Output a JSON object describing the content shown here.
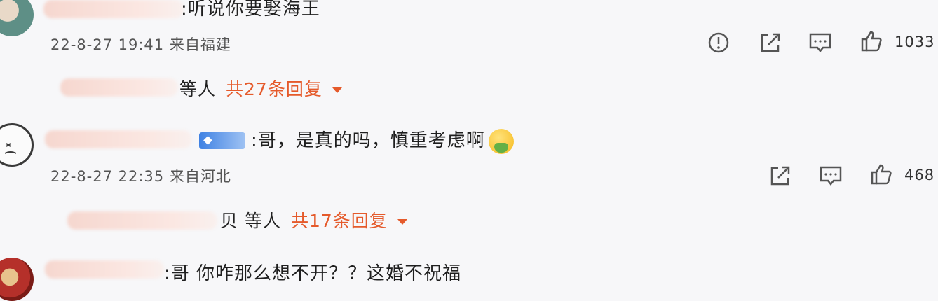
{
  "comments": [
    {
      "text": ":听说你要娶海王",
      "meta": "22-8-27 19:41 来自福建",
      "likes": "1033",
      "replies": {
        "who_suffix": "等人",
        "count": "共27条回复"
      }
    },
    {
      "text": ":哥，是真的吗，慎重考虑啊",
      "meta": "22-8-27 22:35 来自河北",
      "likes": "468",
      "replies": {
        "who_suffix": "贝 等人",
        "count": "共17条回复"
      }
    },
    {
      "text": ":哥 你咋那么想不开？？这婚不祝福"
    }
  ],
  "icons": {
    "report": "report-icon",
    "share": "share-icon",
    "comment": "comment-icon",
    "like": "like-icon"
  }
}
